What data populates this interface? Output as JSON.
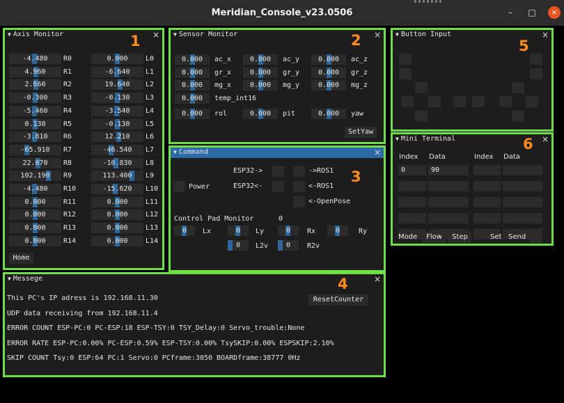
{
  "window": {
    "title": "Meridian_Console_v23.0506",
    "minimize": "–",
    "maximize": "□",
    "close": "×"
  },
  "close_glyph": "×",
  "panels": {
    "axis": {
      "title": "Axis Monitor",
      "number": "1",
      "home_label": "Home",
      "rows": [
        {
          "r_val": "-4.480",
          "r_name": "R0",
          "l_val": "0.000",
          "l_name": "L0"
        },
        {
          "r_val": "4.960",
          "r_name": "R1",
          "l_val": "-6.640",
          "l_name": "L1"
        },
        {
          "r_val": "2.660",
          "r_name": "R2",
          "l_val": "19.640",
          "l_name": "L2"
        },
        {
          "r_val": "-0.300",
          "r_name": "R3",
          "l_val": "-0.130",
          "l_name": "L3"
        },
        {
          "r_val": "-5.460",
          "r_name": "R4",
          "l_val": "-3.540",
          "l_name": "L4"
        },
        {
          "r_val": "0.130",
          "r_name": "R5",
          "l_val": "-0.130",
          "l_name": "L5"
        },
        {
          "r_val": "-3.810",
          "r_name": "R6",
          "l_val": "12.210",
          "l_name": "L6"
        },
        {
          "r_val": "-65.910",
          "r_name": "R7",
          "l_val": "-46.540",
          "l_name": "L7"
        },
        {
          "r_val": "22.070",
          "r_name": "R8",
          "l_val": "-10.830",
          "l_name": "L8"
        },
        {
          "r_val": "102.190",
          "r_name": "R9",
          "l_val": "113.400",
          "l_name": "L9"
        },
        {
          "r_val": "-4.480",
          "r_name": "R10",
          "l_val": "-15.620",
          "l_name": "L10"
        },
        {
          "r_val": "0.000",
          "r_name": "R11",
          "l_val": "0.000",
          "l_name": "L11"
        },
        {
          "r_val": "0.000",
          "r_name": "R12",
          "l_val": "0.000",
          "l_name": "L12"
        },
        {
          "r_val": "0.000",
          "r_name": "R13",
          "l_val": "0.000",
          "l_name": "L13"
        },
        {
          "r_val": "0.000",
          "r_name": "R14",
          "l_val": "0.000",
          "l_name": "L14"
        }
      ]
    },
    "sensor": {
      "title": "Sensor Monitor",
      "number": "2",
      "setyaw_label": "SetYaw",
      "rows": [
        [
          {
            "v": "0.000",
            "n": "ac_x"
          },
          {
            "v": "0.000",
            "n": "ac_y"
          },
          {
            "v": "0.000",
            "n": "ac_z"
          }
        ],
        [
          {
            "v": "0.000",
            "n": "gr_x"
          },
          {
            "v": "0.000",
            "n": "gr_y"
          },
          {
            "v": "0.000",
            "n": "gr_z"
          }
        ],
        [
          {
            "v": "0.000",
            "n": "mg_x"
          },
          {
            "v": "0.000",
            "n": "mg_y"
          },
          {
            "v": "0.000",
            "n": "mg_z"
          }
        ]
      ],
      "temp": {
        "v": "0.000",
        "n": "temp_int16"
      },
      "rpy": [
        {
          "v": "0.000",
          "n": "rol"
        },
        {
          "v": "0.000",
          "n": "pit"
        },
        {
          "v": "0.000",
          "n": "yaw"
        }
      ]
    },
    "command": {
      "title": "Command",
      "number": "3",
      "esp_send": "ESP32->",
      "esp_recv": "ESP32<-",
      "power": "Power",
      "ros_send": "->ROS1",
      "ros_recv": "<-ROS1",
      "openpose": "<-OpenPose",
      "pad_title": "Control Pad Monitor",
      "pad_value": "0",
      "pad": [
        {
          "v": "0",
          "n": "Lx"
        },
        {
          "v": "0",
          "n": "Ly"
        },
        {
          "v": "0",
          "n": "Rx"
        },
        {
          "v": "0",
          "n": "Ry"
        },
        {
          "v": "0",
          "n": "L2v"
        },
        {
          "v": "0",
          "n": "R2v"
        }
      ]
    },
    "message": {
      "title": "Messege",
      "number": "4",
      "reset_label": "ResetCounter",
      "lines": [
        "This PC's IP adress is 192.168.11.30",
        "UDP data receiving from 192.168.11.4",
        "ERROR COUNT ESP-PC:0 PC-ESP:18 ESP-TSY:0 TSY_Delay:0    Servo_trouble:None",
        "ERROR RATE ESP-PC:0.00% PC-ESP:0.59% ESP-TSY:0.00% TsySKIP:0.00% ESPSKIP:2.10%",
        "SKIP COUNT Tsy:0 ESP:64 PC:1 Servo:0 PCframe:3050 BOARDframe:38777 0Hz"
      ]
    },
    "button": {
      "title": "Button Input",
      "number": "5"
    },
    "terminal": {
      "title": "Mini Terminal",
      "number": "6",
      "headers": [
        "Index",
        "Data",
        "Index",
        "Data"
      ],
      "first_row": {
        "index": "0",
        "data": "90"
      },
      "buttons": {
        "mode": "Mode",
        "flow": "Flow",
        "step": "Step",
        "set": "Set",
        "send": "Send"
      }
    }
  },
  "colors": {
    "panel_border": "#6ee046",
    "number": "#ff8c1a",
    "title_active": "#2f6aa8",
    "field": "#2b2b2b",
    "slider_grab": "#2d6699"
  }
}
